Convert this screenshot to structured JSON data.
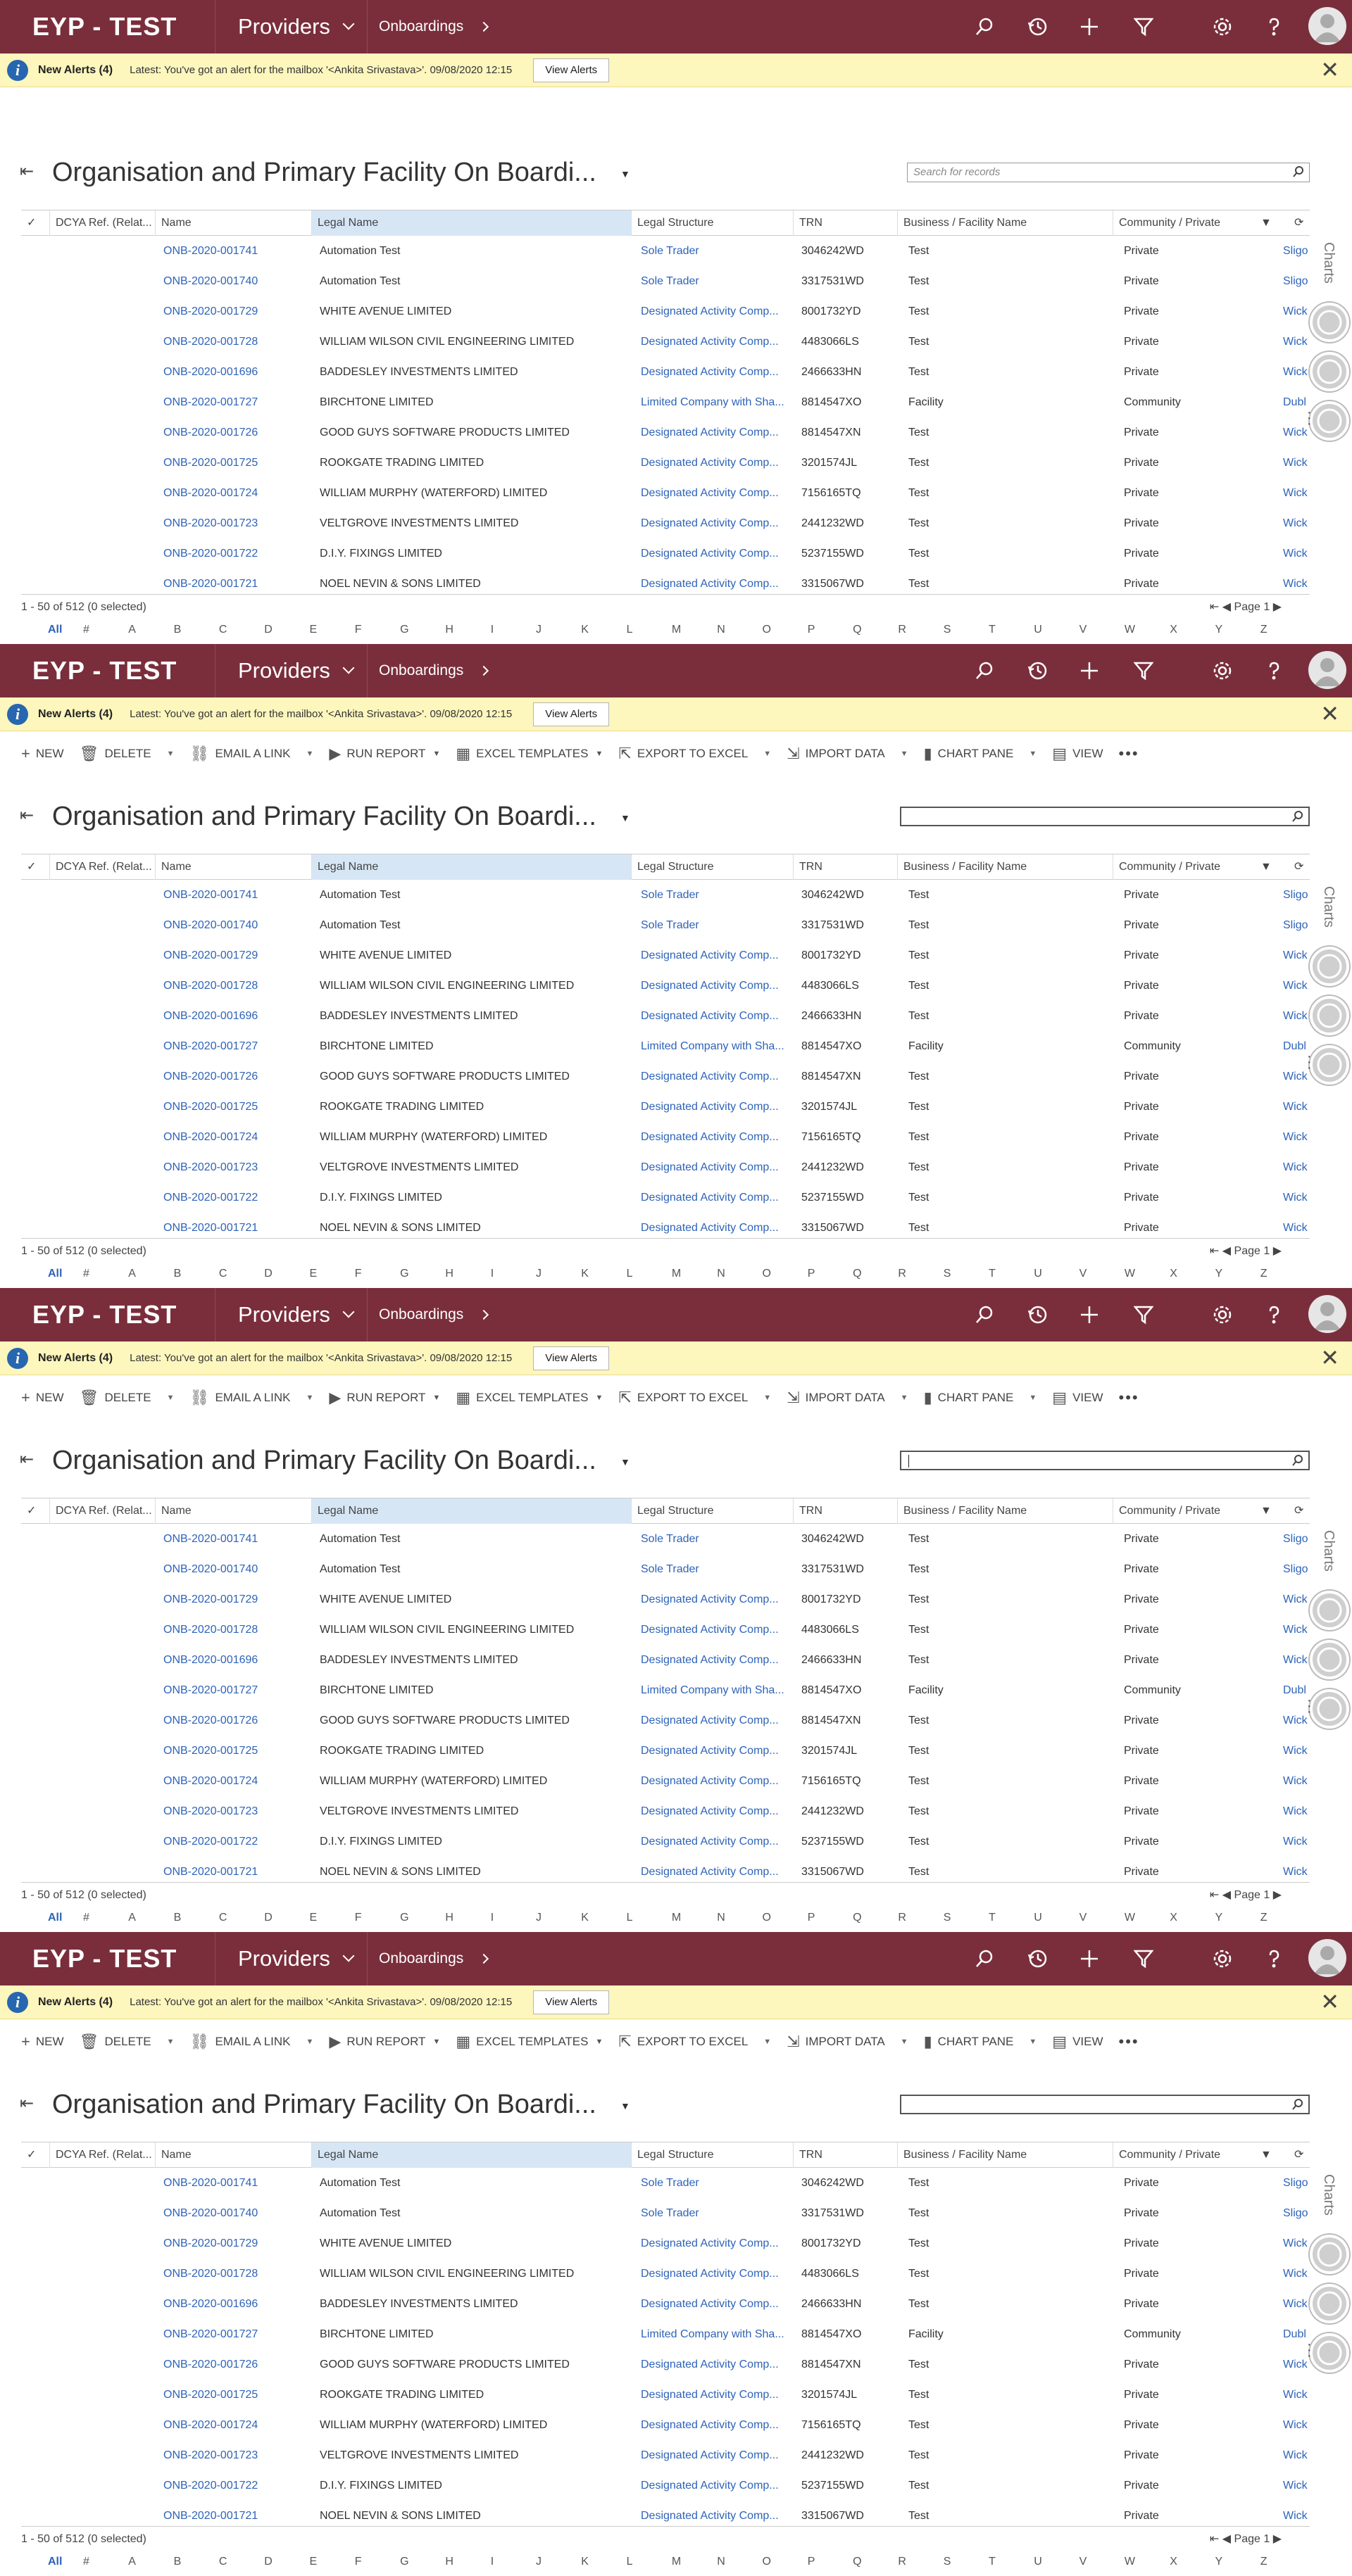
{
  "app": {
    "brand": "EYP - TEST",
    "area": "Providers",
    "breadcrumb": "Onboardings"
  },
  "nav_icons": [
    "search-icon",
    "history-icon",
    "plus-icon",
    "filter-icon",
    "gear-icon",
    "help-icon",
    "user-avatar"
  ],
  "alert": {
    "title": "New Alerts (4)",
    "message": "Latest: You've got an alert for the mailbox '<Ankita Srivastava>'. 09/08/2020 12:15",
    "button": "View Alerts"
  },
  "commands": [
    {
      "icon": "plus-icon",
      "label": "NEW"
    },
    {
      "icon": "trash-icon",
      "label": "DELETE"
    },
    {
      "icon": "link-icon",
      "label": "EMAIL A LINK"
    },
    {
      "icon": "report-icon",
      "label": "RUN REPORT"
    },
    {
      "icon": "excel-icon",
      "label": "EXCEL TEMPLATES"
    },
    {
      "icon": "export-icon",
      "label": "EXPORT TO EXCEL"
    },
    {
      "icon": "import-icon",
      "label": "IMPORT DATA"
    },
    {
      "icon": "chart-icon",
      "label": "CHART PANE"
    },
    {
      "icon": "view-icon",
      "label": "VIEW"
    }
  ],
  "view": {
    "title": "Organisation and Primary Facility On Boardi...",
    "search_placeholder": "Search for records"
  },
  "grid": {
    "columns": [
      "DCYA Ref. (Relat...",
      "Name",
      "Legal Name",
      "Legal Structure",
      "TRN",
      "Business / Facility Name",
      "Community / Private"
    ],
    "rows": [
      {
        "name": "ONB-2020-001741",
        "legal": "Automation Test",
        "structure": "Sole Trader",
        "trn": "3046242WD",
        "business": "Test",
        "community": "Private",
        "county": "Sligo"
      },
      {
        "name": "ONB-2020-001740",
        "legal": "Automation Test",
        "structure": "Sole Trader",
        "trn": "3317531WD",
        "business": "Test",
        "community": "Private",
        "county": "Sligo"
      },
      {
        "name": "ONB-2020-001729",
        "legal": "WHITE AVENUE LIMITED",
        "structure": "Designated Activity Comp...",
        "trn": "8001732YD",
        "business": "Test",
        "community": "Private",
        "county": "Wick"
      },
      {
        "name": "ONB-2020-001728",
        "legal": "WILLIAM WILSON CIVIL ENGINEERING LIMITED",
        "structure": "Designated Activity Comp...",
        "trn": "4483066LS",
        "business": "Test",
        "community": "Private",
        "county": "Wick"
      },
      {
        "name": "ONB-2020-001696",
        "legal": "BADDESLEY INVESTMENTS LIMITED",
        "structure": "Designated Activity Comp...",
        "trn": "2466633HN",
        "business": "Test",
        "community": "Private",
        "county": "Wick"
      },
      {
        "name": "ONB-2020-001727",
        "legal": "BIRCHTONE LIMITED",
        "structure": "Limited Company with Sha...",
        "trn": "8814547XO",
        "business": "Facility",
        "community": "Community",
        "county": "Dubl"
      },
      {
        "name": "ONB-2020-001726",
        "legal": "GOOD GUYS SOFTWARE PRODUCTS LIMITED",
        "structure": "Designated Activity Comp...",
        "trn": "8814547XN",
        "business": "Test",
        "community": "Private",
        "county": "Wick"
      },
      {
        "name": "ONB-2020-001725",
        "legal": "ROOKGATE TRADING LIMITED",
        "structure": "Designated Activity Comp...",
        "trn": "3201574JL",
        "business": "Test",
        "community": "Private",
        "county": "Wick"
      },
      {
        "name": "ONB-2020-001724",
        "legal": "WILLIAM MURPHY (WATERFORD) LIMITED",
        "structure": "Designated Activity Comp...",
        "trn": "7156165TQ",
        "business": "Test",
        "community": "Private",
        "county": "Wick"
      },
      {
        "name": "ONB-2020-001723",
        "legal": "VELTGROVE INVESTMENTS LIMITED",
        "structure": "Designated Activity Comp...",
        "trn": "2441232WD",
        "business": "Test",
        "community": "Private",
        "county": "Wick"
      },
      {
        "name": "ONB-2020-001722",
        "legal": "D.I.Y. FIXINGS LIMITED",
        "structure": "Designated Activity Comp...",
        "trn": "5237155WD",
        "business": "Test",
        "community": "Private",
        "county": "Wick"
      },
      {
        "name": "ONB-2020-001721",
        "legal": "NOEL NEVIN & SONS LIMITED",
        "structure": "Designated Activity Comp...",
        "trn": "3315067WD",
        "business": "Test",
        "community": "Private",
        "county": "Wick"
      }
    ],
    "status": "1 - 50 of 512 (0 selected)",
    "page": "Page 1"
  },
  "alphabet": [
    "All",
    "#",
    "A",
    "B",
    "C",
    "D",
    "E",
    "F",
    "G",
    "H",
    "I",
    "J",
    "K",
    "L",
    "M",
    "N",
    "O",
    "P",
    "Q",
    "R",
    "S",
    "T",
    "U",
    "V",
    "W",
    "X",
    "Y",
    "Z"
  ],
  "side": {
    "label": "Charts"
  },
  "colors": {
    "nav": "#7a2e3b",
    "alert": "#fdf6bd",
    "link": "#2e63b8",
    "selected_header": "#d6e6f5"
  },
  "frames": [
    {
      "show_commands": false,
      "search_state": "placeholder"
    },
    {
      "show_commands": true,
      "search_state": "empty"
    },
    {
      "show_commands": true,
      "search_state": "focused"
    },
    {
      "show_commands": true,
      "search_state": "empty"
    }
  ]
}
